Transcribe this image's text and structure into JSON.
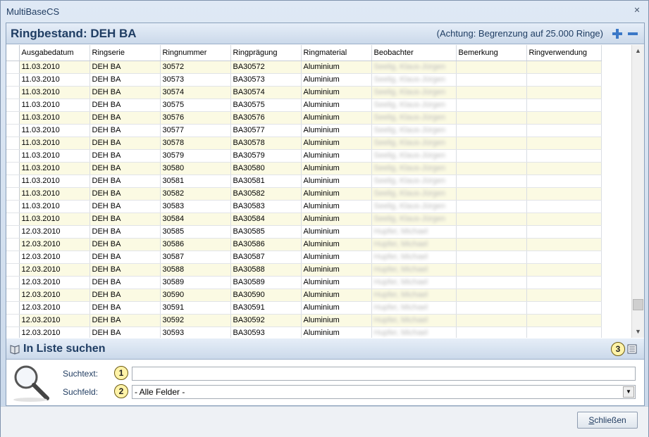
{
  "window": {
    "title": "MultiBaseCS"
  },
  "header": {
    "title": "Ringbestand: DEH BA",
    "note": "(Achtung: Begrenzung auf 25.000 Ringe)",
    "add_icon": "plus-icon",
    "remove_icon": "minus-icon"
  },
  "table": {
    "columns": [
      "Ausgabedatum",
      "Ringserie",
      "Ringnummer",
      "Ringprägung",
      "Ringmaterial",
      "Beobachter",
      "Bemerkung",
      "Ringverwendung"
    ],
    "rows": [
      [
        "11.03.2010",
        "DEH BA",
        "30572",
        "BA30572",
        "Aluminium",
        "Seelig, Klaus-Jürgen",
        "",
        ""
      ],
      [
        "11.03.2010",
        "DEH BA",
        "30573",
        "BA30573",
        "Aluminium",
        "Seelig, Klaus-Jürgen",
        "",
        ""
      ],
      [
        "11.03.2010",
        "DEH BA",
        "30574",
        "BA30574",
        "Aluminium",
        "Seelig, Klaus-Jürgen",
        "",
        ""
      ],
      [
        "11.03.2010",
        "DEH BA",
        "30575",
        "BA30575",
        "Aluminium",
        "Seelig, Klaus-Jürgen",
        "",
        ""
      ],
      [
        "11.03.2010",
        "DEH BA",
        "30576",
        "BA30576",
        "Aluminium",
        "Seelig, Klaus-Jürgen",
        "",
        ""
      ],
      [
        "11.03.2010",
        "DEH BA",
        "30577",
        "BA30577",
        "Aluminium",
        "Seelig, Klaus-Jürgen",
        "",
        ""
      ],
      [
        "11.03.2010",
        "DEH BA",
        "30578",
        "BA30578",
        "Aluminium",
        "Seelig, Klaus-Jürgen",
        "",
        ""
      ],
      [
        "11.03.2010",
        "DEH BA",
        "30579",
        "BA30579",
        "Aluminium",
        "Seelig, Klaus-Jürgen",
        "",
        ""
      ],
      [
        "11.03.2010",
        "DEH BA",
        "30580",
        "BA30580",
        "Aluminium",
        "Seelig, Klaus-Jürgen",
        "",
        ""
      ],
      [
        "11.03.2010",
        "DEH BA",
        "30581",
        "BA30581",
        "Aluminium",
        "Seelig, Klaus-Jürgen",
        "",
        ""
      ],
      [
        "11.03.2010",
        "DEH BA",
        "30582",
        "BA30582",
        "Aluminium",
        "Seelig, Klaus-Jürgen",
        "",
        ""
      ],
      [
        "11.03.2010",
        "DEH BA",
        "30583",
        "BA30583",
        "Aluminium",
        "Seelig, Klaus-Jürgen",
        "",
        ""
      ],
      [
        "11.03.2010",
        "DEH BA",
        "30584",
        "BA30584",
        "Aluminium",
        "Seelig, Klaus-Jürgen",
        "",
        ""
      ],
      [
        "12.03.2010",
        "DEH BA",
        "30585",
        "BA30585",
        "Aluminium",
        "Hupfer, Michael",
        "",
        ""
      ],
      [
        "12.03.2010",
        "DEH BA",
        "30586",
        "BA30586",
        "Aluminium",
        "Hupfer, Michael",
        "",
        ""
      ],
      [
        "12.03.2010",
        "DEH BA",
        "30587",
        "BA30587",
        "Aluminium",
        "Hupfer, Michael",
        "",
        ""
      ],
      [
        "12.03.2010",
        "DEH BA",
        "30588",
        "BA30588",
        "Aluminium",
        "Hupfer, Michael",
        "",
        ""
      ],
      [
        "12.03.2010",
        "DEH BA",
        "30589",
        "BA30589",
        "Aluminium",
        "Hupfer, Michael",
        "",
        ""
      ],
      [
        "12.03.2010",
        "DEH BA",
        "30590",
        "BA30590",
        "Aluminium",
        "Hupfer, Michael",
        "",
        ""
      ],
      [
        "12.03.2010",
        "DEH BA",
        "30591",
        "BA30591",
        "Aluminium",
        "Hupfer, Michael",
        "",
        ""
      ],
      [
        "12.03.2010",
        "DEH BA",
        "30592",
        "BA30592",
        "Aluminium",
        "Hupfer, Michael",
        "",
        ""
      ],
      [
        "12.03.2010",
        "DEH BA",
        "30593",
        "BA30593",
        "Aluminium",
        "Hupfer, Michael",
        "",
        ""
      ]
    ]
  },
  "search": {
    "title": "In Liste suchen",
    "text_label": "Suchtext:",
    "text_value": "",
    "field_label": "Suchfeld:",
    "field_value": "- Alle Felder -",
    "badges": [
      "1",
      "2",
      "3"
    ],
    "icons": [
      "book-icon",
      "magnifier-icon",
      "list-options-icon"
    ]
  },
  "footer": {
    "close_label_first": "S",
    "close_label_rest": "chließen"
  },
  "colors": {
    "accent": "#1f3d63",
    "odd_row": "#fbfae3",
    "badge": "#fff3a8"
  }
}
